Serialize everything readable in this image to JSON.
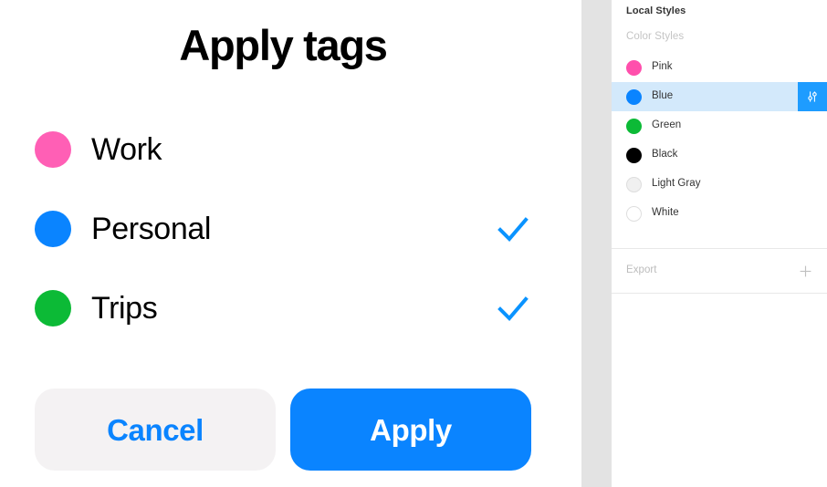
{
  "canvas": {
    "title": "Apply tags",
    "tags": [
      {
        "label": "Work",
        "color": "#ff5fb5",
        "checked": false
      },
      {
        "label": "Personal",
        "color": "#0a84ff",
        "checked": true
      },
      {
        "label": "Trips",
        "color": "#0cba36",
        "checked": true
      }
    ],
    "check_icon": "check-icon",
    "check_color": "#0a93ff",
    "buttons": {
      "cancel_label": "Cancel",
      "cancel_text_color": "#0a84ff",
      "cancel_bg_color": "#f4f2f3",
      "apply_label": "Apply",
      "apply_text_color": "#ffffff",
      "apply_bg_color": "#0a84ff"
    }
  },
  "panel": {
    "title": "Local Styles",
    "section_label": "Color Styles",
    "selected_style": "Blue",
    "highlight_color": "#d3e9fb",
    "edit_button": {
      "icon": "sliders-icon",
      "bg_color": "#1e9cff"
    },
    "styles": [
      {
        "name": "Pink",
        "color": "#ff4fac",
        "outlined": false,
        "selected": false
      },
      {
        "name": "Blue",
        "color": "#0a84ff",
        "outlined": false,
        "selected": true
      },
      {
        "name": "Green",
        "color": "#0cba36",
        "outlined": false,
        "selected": false
      },
      {
        "name": "Black",
        "color": "#000000",
        "outlined": false,
        "selected": false
      },
      {
        "name": "Light Gray",
        "color": "#f0f0f0",
        "outlined": true,
        "selected": false
      },
      {
        "name": "White",
        "color": "#ffffff",
        "outlined": true,
        "selected": false
      }
    ],
    "export": {
      "label": "Export",
      "add_icon": "plus-icon"
    }
  }
}
